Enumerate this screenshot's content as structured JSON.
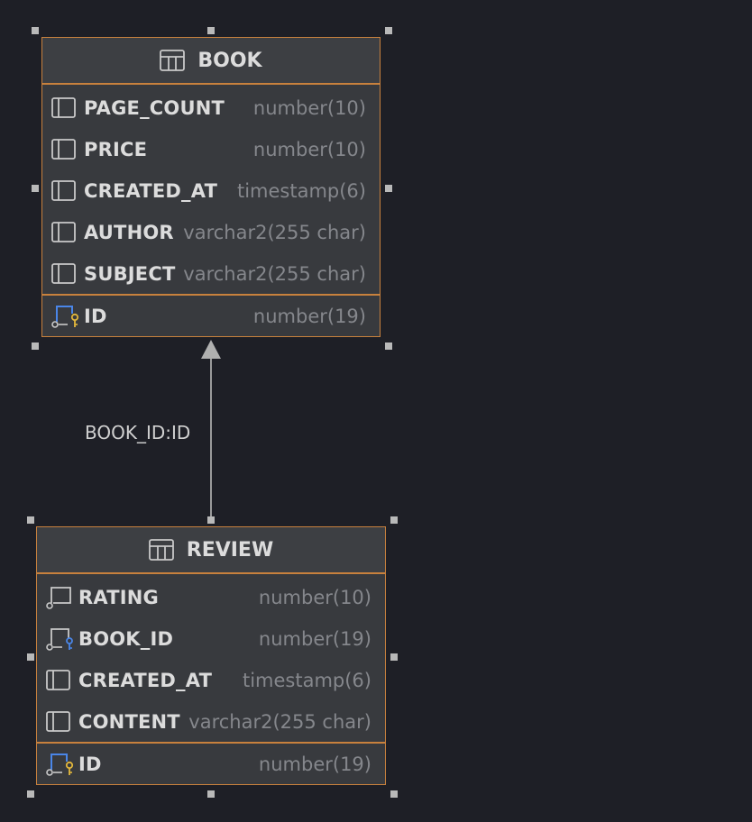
{
  "tables": {
    "book": {
      "name": "BOOK",
      "columns": [
        {
          "name": "PAGE_COUNT",
          "type": "number(10)",
          "icon": "column-icon"
        },
        {
          "name": "PRICE",
          "type": "number(10)",
          "icon": "column-icon"
        },
        {
          "name": "CREATED_AT",
          "type": "timestamp(6)",
          "icon": "column-icon"
        },
        {
          "name": "AUTHOR",
          "type": "varchar2(255 char)",
          "icon": "column-icon"
        },
        {
          "name": "SUBJECT",
          "type": "varchar2(255 char)",
          "icon": "column-icon"
        }
      ],
      "pk": {
        "name": "ID",
        "type": "number(19)",
        "icon": "primary-key-icon"
      }
    },
    "review": {
      "name": "REVIEW",
      "columns": [
        {
          "name": "RATING",
          "type": "number(10)",
          "icon": "column-notnull-icon"
        },
        {
          "name": "BOOK_ID",
          "type": "number(19)",
          "icon": "foreign-key-icon"
        },
        {
          "name": "CREATED_AT",
          "type": "timestamp(6)",
          "icon": "column-icon"
        },
        {
          "name": "CONTENT",
          "type": "varchar2(255 char)",
          "icon": "column-icon"
        }
      ],
      "pk": {
        "name": "ID",
        "type": "number(19)",
        "icon": "primary-key-icon"
      }
    }
  },
  "relationship": {
    "label": "BOOK_ID:ID",
    "from": "REVIEW",
    "to": "BOOK"
  },
  "colors": {
    "background": "#1e1f26",
    "table_border": "#c8813d",
    "primary_key": "#e2b73c",
    "foreign_key": "#4a86e8"
  }
}
